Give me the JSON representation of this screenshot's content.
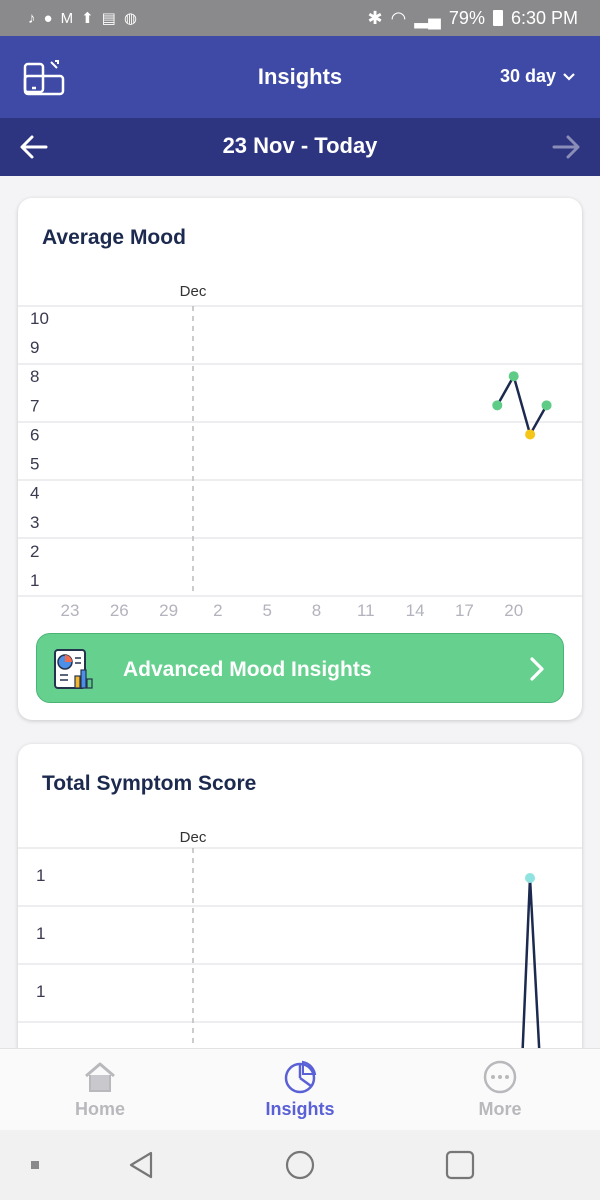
{
  "status_bar": {
    "battery": "79%",
    "time": "6:30 PM"
  },
  "app_bar": {
    "title": "Insights",
    "range": "30 day"
  },
  "date_bar": {
    "range": "23 Nov - Today"
  },
  "mood_card": {
    "title": "Average Mood",
    "cta_label": "Advanced Mood Insights"
  },
  "symptom_card": {
    "title": "Total Symptom Score"
  },
  "bottom_nav": {
    "home": "Home",
    "insights": "Insights",
    "more": "More",
    "active": "Insights"
  },
  "colors": {
    "app_bar": "#3f4aa6",
    "date_bar": "#2e3580",
    "cta": "#66d08f",
    "accent": "#5a60d6"
  },
  "chart_data": [
    {
      "type": "line",
      "title": "Average Mood",
      "month_marker": "Dec",
      "x_ticks": [
        "23",
        "26",
        "29",
        "2",
        "5",
        "8",
        "11",
        "14",
        "17",
        "20"
      ],
      "y_ticks": [
        "1",
        "2",
        "3",
        "4",
        "5",
        "6",
        "7",
        "8",
        "9",
        "10"
      ],
      "ylim": [
        1,
        10
      ],
      "grid": true,
      "points": [
        {
          "x": "Dec 19",
          "y": 7,
          "color": "#5ecb87"
        },
        {
          "x": "Dec 20",
          "y": 8,
          "color": "#5ecb87"
        },
        {
          "x": "Dec 21",
          "y": 6,
          "color": "#f5c518"
        },
        {
          "x": "Dec 22",
          "y": 7,
          "color": "#5ecb87"
        }
      ]
    },
    {
      "type": "line",
      "title": "Total Symptom Score",
      "month_marker": "Dec",
      "y_ticks": [
        "1",
        "1",
        "1"
      ],
      "grid": true,
      "peak_marker_color": "#8fe3e0"
    }
  ]
}
